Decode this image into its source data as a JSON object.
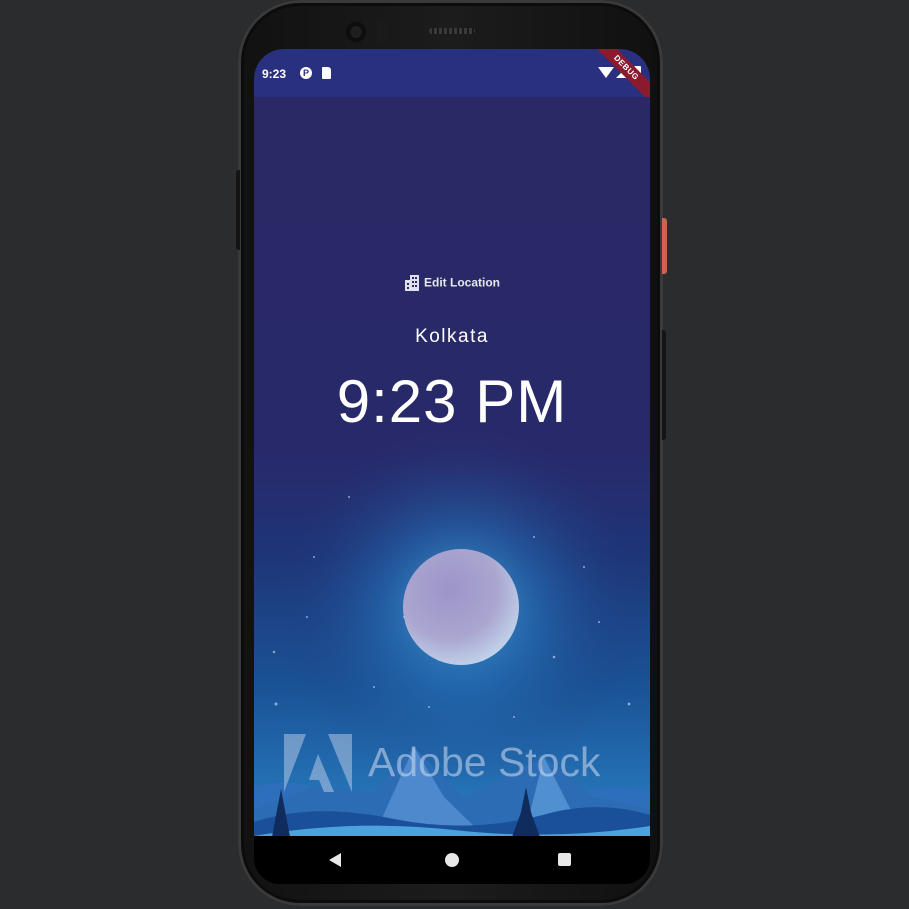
{
  "status_bar": {
    "time": "9:23",
    "app_icon": "p-badge-icon",
    "sd_icon": "sd-card-icon",
    "right_icons": [
      "wifi-icon",
      "signal-icon",
      "battery-icon"
    ]
  },
  "debug_banner": "DEBUG",
  "edit_location": {
    "icon": "building-icon",
    "label": "Edit Location"
  },
  "location": "Kolkata",
  "time": "9:23 PM",
  "background": {
    "scene": "night",
    "watermark": "Adobe Stock"
  },
  "navigation": {
    "back": "back-icon",
    "home": "home-icon",
    "recents": "recents-icon"
  },
  "colors": {
    "status_bar": "#2a3080",
    "content_bg": "#2a2965",
    "text": "#ffffff",
    "debug_banner": "#8b1a2f",
    "hardware_button": "#c9654b"
  }
}
